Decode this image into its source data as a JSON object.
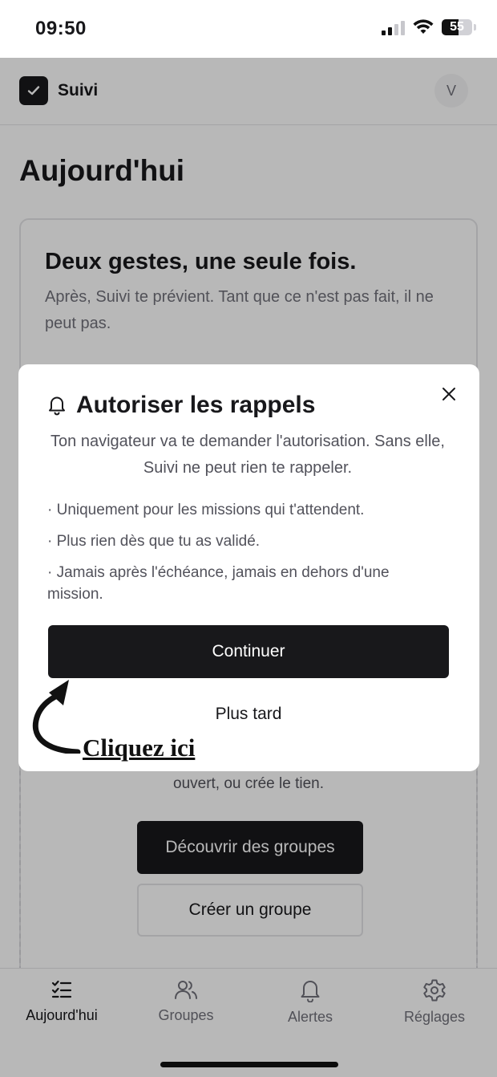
{
  "status_bar": {
    "time": "09:50",
    "battery": "55"
  },
  "header": {
    "app_name": "Suivi",
    "avatar_initial": "V"
  },
  "page": {
    "title": "Aujourd'hui"
  },
  "intro_card": {
    "title": "Deux gestes, une seule fois.",
    "text": "Après, Suivi te prévient. Tant que ce n'est pas fait, il ne peut pas."
  },
  "empty_state": {
    "text": "ouvert, ou crée le tien.",
    "discover_label": "Découvrir des groupes",
    "create_label": "Créer un groupe"
  },
  "modal": {
    "icon": "bell-icon",
    "title": "Autoriser les rappels",
    "description": "Ton navigateur va te demander l'autorisation. Sans elle, Suivi ne peut rien te rappeler.",
    "points": [
      "· Uniquement pour les missions qui t'attendent.",
      "· Plus rien dès que tu as validé.",
      "· Jamais après l'échéance, jamais en dehors d'une mission."
    ],
    "continue_label": "Continuer",
    "later_label": "Plus tard",
    "annotation": "Cliquez ici"
  },
  "tabbar": {
    "items": [
      {
        "label": "Aujourd'hui",
        "icon": "checklist-icon",
        "active": true
      },
      {
        "label": "Groupes",
        "icon": "users-icon",
        "active": false
      },
      {
        "label": "Alertes",
        "icon": "bell-icon",
        "active": false
      },
      {
        "label": "Réglages",
        "icon": "gear-icon",
        "active": false
      }
    ]
  },
  "colors": {
    "primary": "#18181b",
    "muted": "#71717a",
    "border": "#e4e4e7"
  }
}
